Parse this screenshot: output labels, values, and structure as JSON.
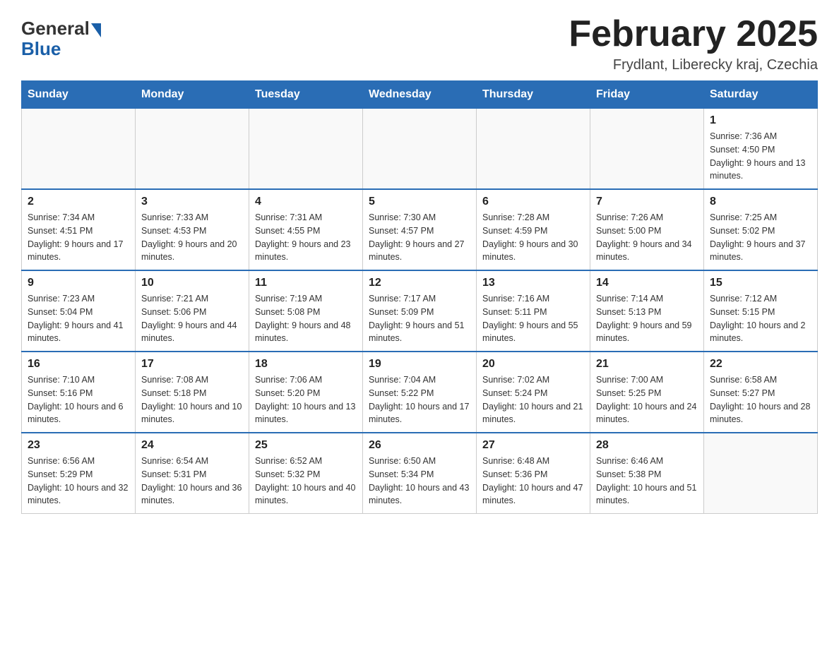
{
  "header": {
    "logo_general": "General",
    "logo_blue": "Blue",
    "title": "February 2025",
    "location": "Frydlant, Liberecky kraj, Czechia"
  },
  "days_of_week": [
    "Sunday",
    "Monday",
    "Tuesday",
    "Wednesday",
    "Thursday",
    "Friday",
    "Saturday"
  ],
  "weeks": [
    [
      {
        "day": "",
        "info": ""
      },
      {
        "day": "",
        "info": ""
      },
      {
        "day": "",
        "info": ""
      },
      {
        "day": "",
        "info": ""
      },
      {
        "day": "",
        "info": ""
      },
      {
        "day": "",
        "info": ""
      },
      {
        "day": "1",
        "info": "Sunrise: 7:36 AM\nSunset: 4:50 PM\nDaylight: 9 hours and 13 minutes."
      }
    ],
    [
      {
        "day": "2",
        "info": "Sunrise: 7:34 AM\nSunset: 4:51 PM\nDaylight: 9 hours and 17 minutes."
      },
      {
        "day": "3",
        "info": "Sunrise: 7:33 AM\nSunset: 4:53 PM\nDaylight: 9 hours and 20 minutes."
      },
      {
        "day": "4",
        "info": "Sunrise: 7:31 AM\nSunset: 4:55 PM\nDaylight: 9 hours and 23 minutes."
      },
      {
        "day": "5",
        "info": "Sunrise: 7:30 AM\nSunset: 4:57 PM\nDaylight: 9 hours and 27 minutes."
      },
      {
        "day": "6",
        "info": "Sunrise: 7:28 AM\nSunset: 4:59 PM\nDaylight: 9 hours and 30 minutes."
      },
      {
        "day": "7",
        "info": "Sunrise: 7:26 AM\nSunset: 5:00 PM\nDaylight: 9 hours and 34 minutes."
      },
      {
        "day": "8",
        "info": "Sunrise: 7:25 AM\nSunset: 5:02 PM\nDaylight: 9 hours and 37 minutes."
      }
    ],
    [
      {
        "day": "9",
        "info": "Sunrise: 7:23 AM\nSunset: 5:04 PM\nDaylight: 9 hours and 41 minutes."
      },
      {
        "day": "10",
        "info": "Sunrise: 7:21 AM\nSunset: 5:06 PM\nDaylight: 9 hours and 44 minutes."
      },
      {
        "day": "11",
        "info": "Sunrise: 7:19 AM\nSunset: 5:08 PM\nDaylight: 9 hours and 48 minutes."
      },
      {
        "day": "12",
        "info": "Sunrise: 7:17 AM\nSunset: 5:09 PM\nDaylight: 9 hours and 51 minutes."
      },
      {
        "day": "13",
        "info": "Sunrise: 7:16 AM\nSunset: 5:11 PM\nDaylight: 9 hours and 55 minutes."
      },
      {
        "day": "14",
        "info": "Sunrise: 7:14 AM\nSunset: 5:13 PM\nDaylight: 9 hours and 59 minutes."
      },
      {
        "day": "15",
        "info": "Sunrise: 7:12 AM\nSunset: 5:15 PM\nDaylight: 10 hours and 2 minutes."
      }
    ],
    [
      {
        "day": "16",
        "info": "Sunrise: 7:10 AM\nSunset: 5:16 PM\nDaylight: 10 hours and 6 minutes."
      },
      {
        "day": "17",
        "info": "Sunrise: 7:08 AM\nSunset: 5:18 PM\nDaylight: 10 hours and 10 minutes."
      },
      {
        "day": "18",
        "info": "Sunrise: 7:06 AM\nSunset: 5:20 PM\nDaylight: 10 hours and 13 minutes."
      },
      {
        "day": "19",
        "info": "Sunrise: 7:04 AM\nSunset: 5:22 PM\nDaylight: 10 hours and 17 minutes."
      },
      {
        "day": "20",
        "info": "Sunrise: 7:02 AM\nSunset: 5:24 PM\nDaylight: 10 hours and 21 minutes."
      },
      {
        "day": "21",
        "info": "Sunrise: 7:00 AM\nSunset: 5:25 PM\nDaylight: 10 hours and 24 minutes."
      },
      {
        "day": "22",
        "info": "Sunrise: 6:58 AM\nSunset: 5:27 PM\nDaylight: 10 hours and 28 minutes."
      }
    ],
    [
      {
        "day": "23",
        "info": "Sunrise: 6:56 AM\nSunset: 5:29 PM\nDaylight: 10 hours and 32 minutes."
      },
      {
        "day": "24",
        "info": "Sunrise: 6:54 AM\nSunset: 5:31 PM\nDaylight: 10 hours and 36 minutes."
      },
      {
        "day": "25",
        "info": "Sunrise: 6:52 AM\nSunset: 5:32 PM\nDaylight: 10 hours and 40 minutes."
      },
      {
        "day": "26",
        "info": "Sunrise: 6:50 AM\nSunset: 5:34 PM\nDaylight: 10 hours and 43 minutes."
      },
      {
        "day": "27",
        "info": "Sunrise: 6:48 AM\nSunset: 5:36 PM\nDaylight: 10 hours and 47 minutes."
      },
      {
        "day": "28",
        "info": "Sunrise: 6:46 AM\nSunset: 5:38 PM\nDaylight: 10 hours and 51 minutes."
      },
      {
        "day": "",
        "info": ""
      }
    ]
  ]
}
